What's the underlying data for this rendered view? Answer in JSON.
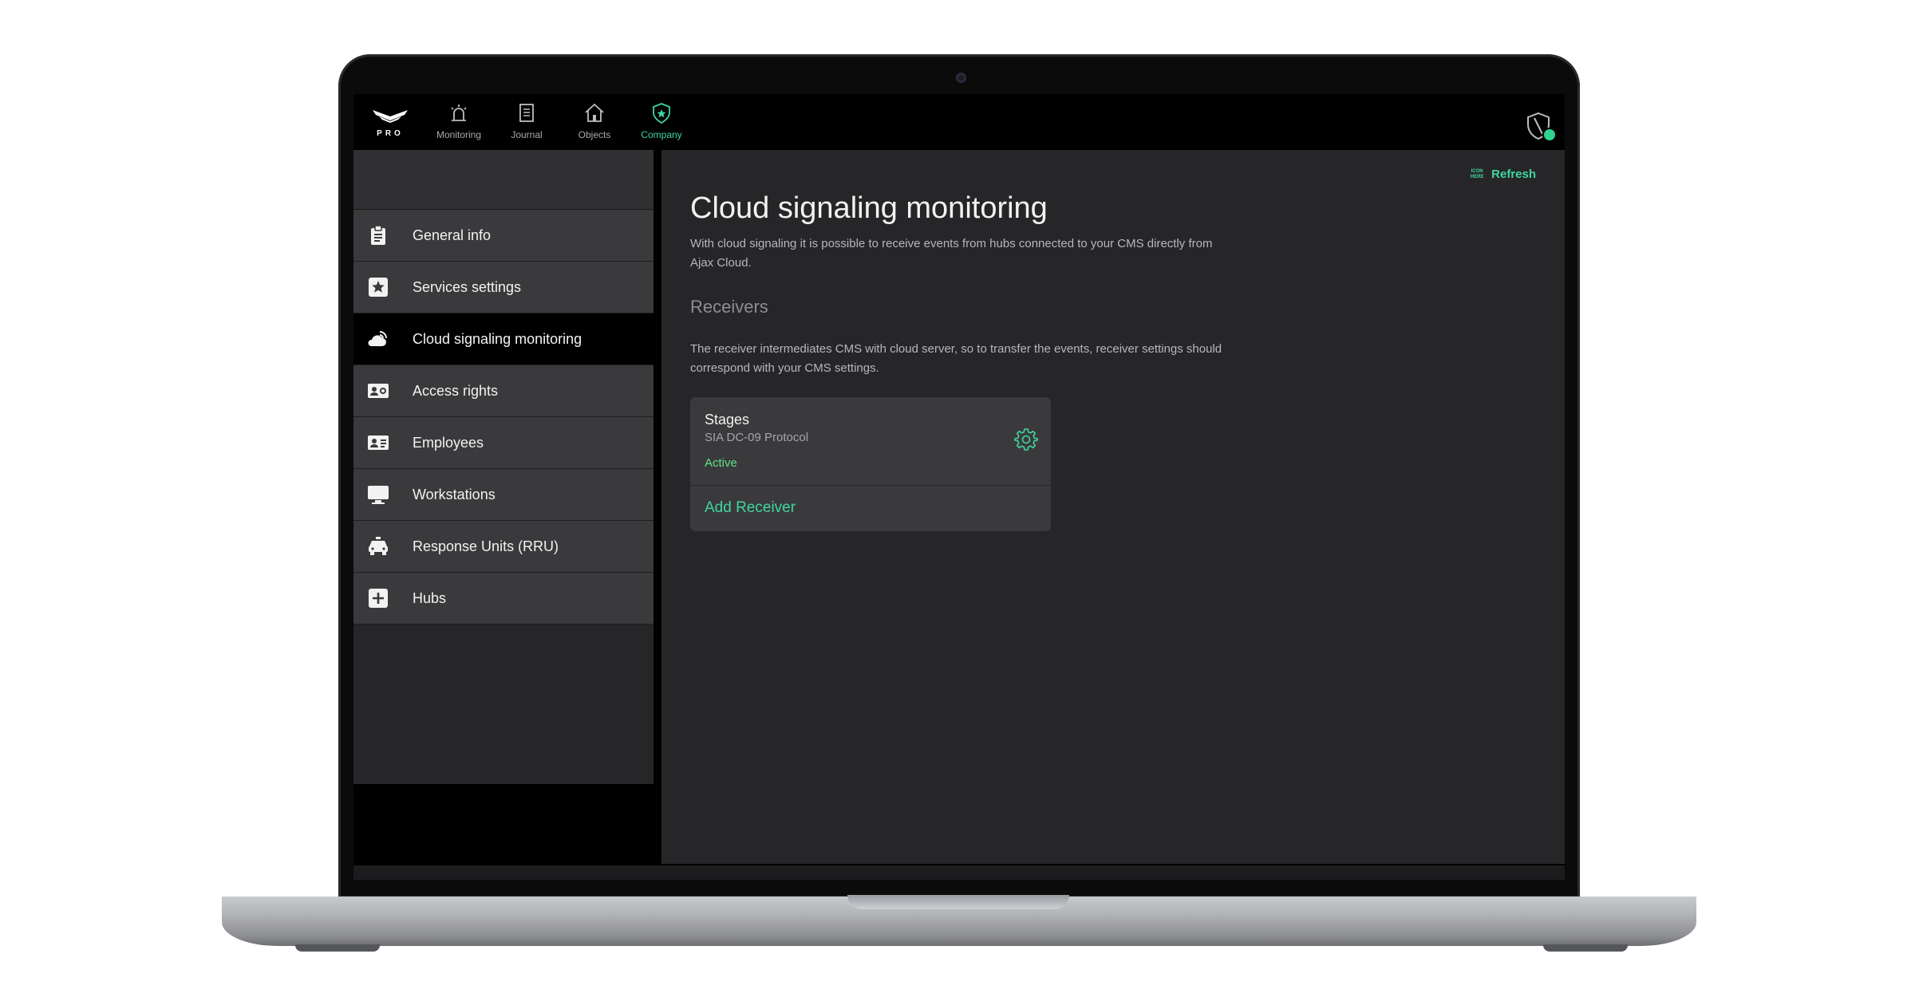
{
  "topnav": {
    "logo_text": "PRO",
    "items": [
      {
        "label": "Monitoring",
        "icon": "siren-icon"
      },
      {
        "label": "Journal",
        "icon": "journal-icon"
      },
      {
        "label": "Objects",
        "icon": "home-icon"
      },
      {
        "label": "Company",
        "icon": "shield-star-icon",
        "active": true
      }
    ],
    "accent_color": "#3fd6a1",
    "status_color": "#2fd38e"
  },
  "sidebar": {
    "items": [
      {
        "label": "General info",
        "icon": "clipboard-icon"
      },
      {
        "label": "Services settings",
        "icon": "star-icon"
      },
      {
        "label": "Cloud signaling monitoring",
        "icon": "cloud-signal-icon",
        "active": true
      },
      {
        "label": "Access rights",
        "icon": "id-card-icon"
      },
      {
        "label": "Employees",
        "icon": "employee-card-icon"
      },
      {
        "label": "Workstations",
        "icon": "monitor-icon"
      },
      {
        "label": "Response Units (RRU)",
        "icon": "car-icon"
      },
      {
        "label": "Hubs",
        "icon": "plus-square-icon"
      }
    ]
  },
  "main": {
    "refresh": {
      "icon_text": "ICON HERE",
      "label": "Refresh"
    },
    "title": "Cloud signaling monitoring",
    "description": "With cloud signaling it is possible to receive events from hubs connected to your CMS directly from Ajax Cloud.",
    "receivers": {
      "title": "Receivers",
      "description": "The receiver intermediates CMS with cloud server, so to transfer the events, receiver settings should correspond with your CMS settings.",
      "card": {
        "name": "Stages",
        "protocol": "SIA DC-09 Protocol",
        "status": "Active",
        "add_label": "Add Receiver"
      }
    }
  }
}
